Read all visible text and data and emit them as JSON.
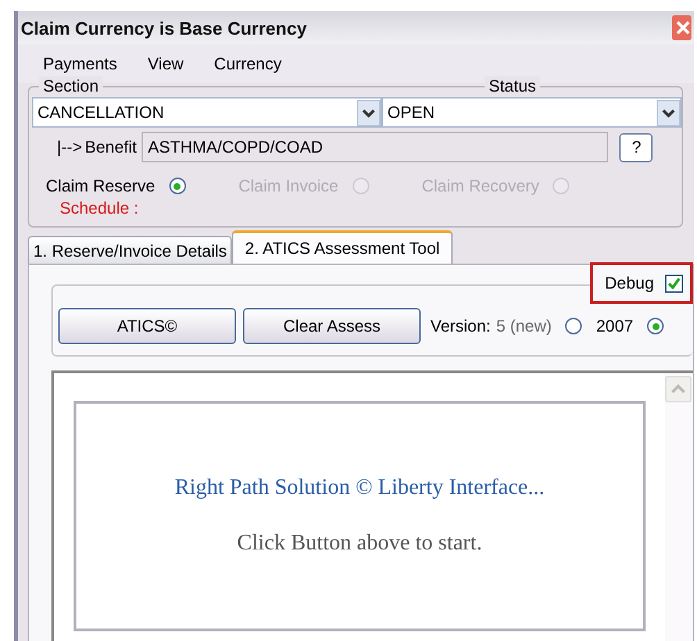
{
  "window": {
    "title": "Claim Currency is Base Currency"
  },
  "menu": [
    "Payments",
    "View",
    "Currency"
  ],
  "section": {
    "label": "Section",
    "value": "CANCELLATION"
  },
  "status": {
    "label": "Status",
    "value": "OPEN"
  },
  "benefit": {
    "prefix": "|-->",
    "label": "Benefit",
    "value": "ASTHMA/COPD/COAD",
    "help": "?"
  },
  "claim_types": [
    {
      "label": "Claim Reserve",
      "selected": true,
      "disabled": false
    },
    {
      "label": "Claim Invoice",
      "selected": false,
      "disabled": true
    },
    {
      "label": "Claim Recovery",
      "selected": false,
      "disabled": true
    }
  ],
  "schedule": "Schedule :",
  "tabs": [
    {
      "label": "1. Reserve/Invoice Details",
      "selected": false
    },
    {
      "label": "2. ATICS Assessment Tool",
      "selected": true
    }
  ],
  "debug": {
    "label": "Debug",
    "checked": true,
    "highlighted": true
  },
  "buttons": [
    "ATICS©",
    "Clear Assess"
  ],
  "version": {
    "label": "Version:",
    "options": [
      {
        "label": "5 (new)",
        "selected": false
      },
      {
        "label": "2007",
        "selected": true
      }
    ]
  },
  "viewer": {
    "title": "Right Path Solution © Liberty Interface...",
    "message": "Click Button above to start."
  }
}
